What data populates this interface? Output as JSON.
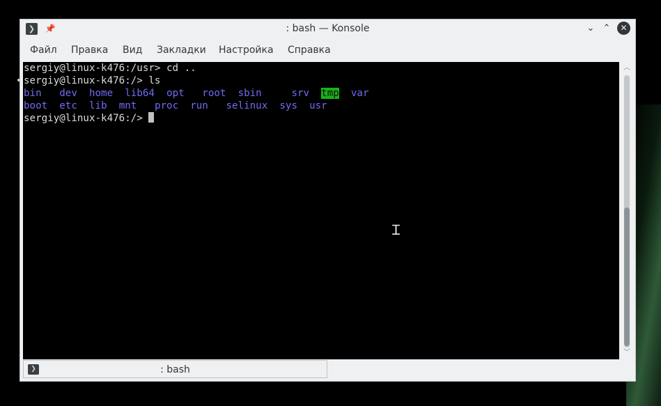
{
  "window": {
    "title": ": bash — Konsole",
    "icon": "terminal-icon",
    "controls": {
      "minimize": "⌄",
      "maximize": "⌃",
      "close": "✕"
    }
  },
  "menubar": {
    "items": [
      "Файл",
      "Правка",
      "Вид",
      "Закладки",
      "Настройка",
      "Справка"
    ]
  },
  "terminal": {
    "line1": "sergiy@linux-k476:/usr> cd ..",
    "line2": "sergiy@linux-k476:/> ls",
    "ls_row1": [
      "bin",
      "dev",
      "home",
      "lib64",
      "opt",
      "root",
      "sbin",
      "srv",
      "tmp",
      "var"
    ],
    "ls_row2": [
      "boot",
      "etc",
      "lib",
      "mnt",
      "proc",
      "run",
      "selinux",
      "sys",
      "usr"
    ],
    "prompt": "sergiy@linux-k476:/> ",
    "highlighted_dir": "tmp",
    "colors": {
      "directory": "#6f6cf3",
      "highlight_bg": "#18b218",
      "text": "#d9dcdc"
    }
  },
  "scrollbar": {
    "position_fraction": 1.0,
    "visible_fraction": 0.5
  },
  "tabbar": {
    "tabs": [
      {
        "label": ": bash",
        "icon": "terminal-icon"
      }
    ]
  }
}
